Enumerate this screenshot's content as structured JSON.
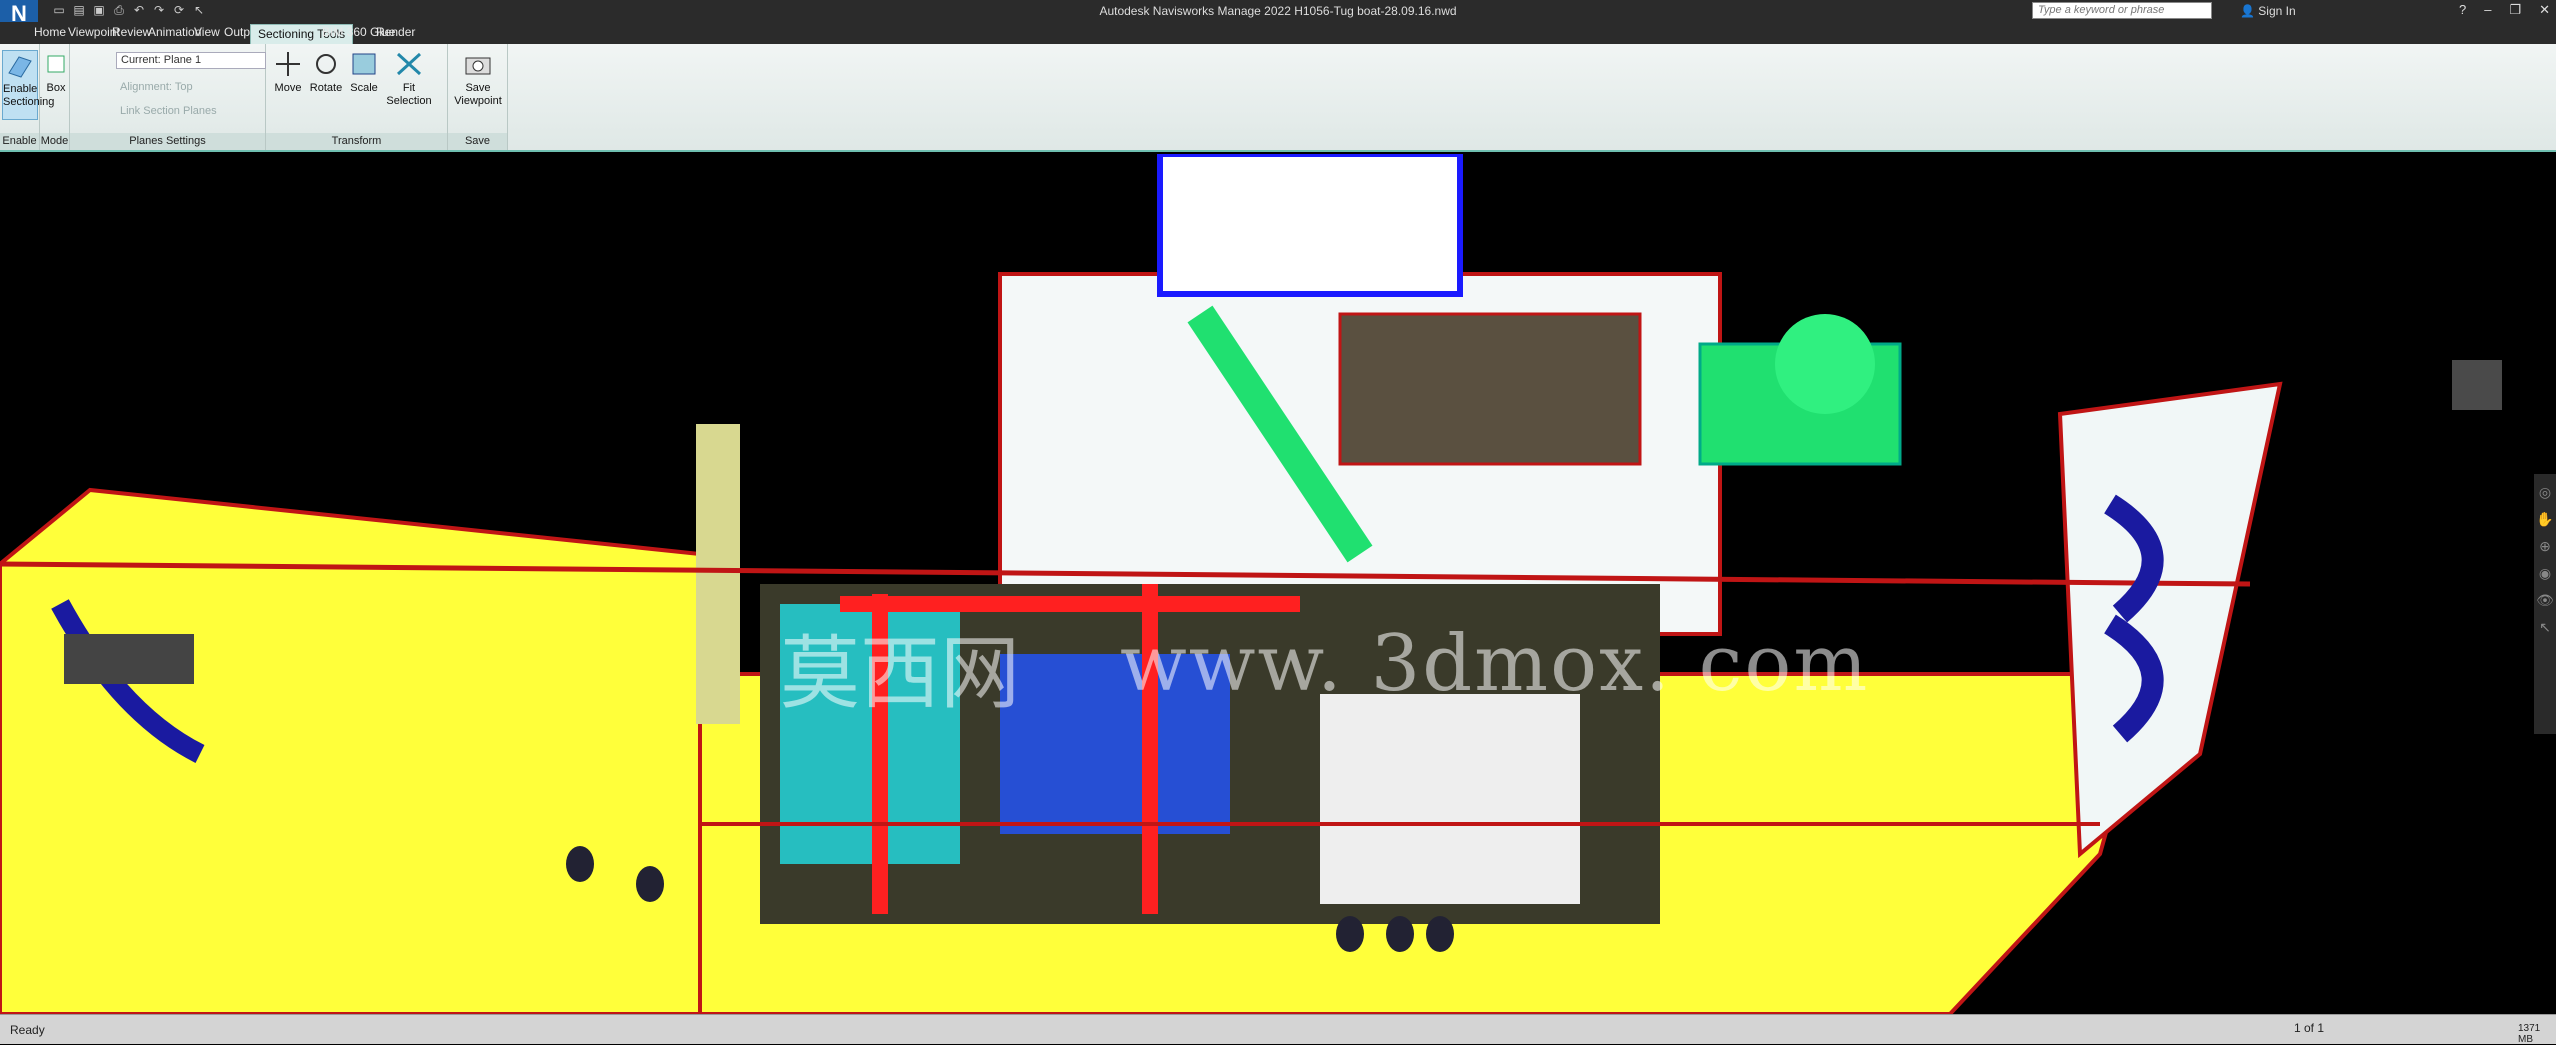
{
  "app": {
    "logo_letter": "N",
    "title": "Autodesk Navisworks Manage 2022    H1056-Tug boat-28.09.16.nwd",
    "search_placeholder": "Type a keyword or phrase",
    "sign_in": "Sign In"
  },
  "tabs": [
    "Home",
    "Viewpoint",
    "Review",
    "Animation",
    "View",
    "Output",
    "Sectioning Tools",
    "BIM 360 Glue",
    "Render"
  ],
  "active_tab": "Sectioning Tools",
  "ribbon": {
    "enable_label": "Enable\nSectioning",
    "box_label": "Box",
    "current_plane": "Current: Plane 1",
    "alignment": "Alignment: Top",
    "link_section": "Link Section Planes",
    "move_label": "Move",
    "rotate_label": "Rotate",
    "scale_label": "Scale",
    "fit_label": "Fit\nSelection",
    "save_label": "Save\nViewpoint",
    "panels": [
      "Enable",
      "Mode",
      "Planes Settings",
      "Transform",
      "Save"
    ]
  },
  "viewport": {
    "watermark_cn": "莫西网",
    "watermark": "www. 3dmox. com"
  },
  "status": {
    "ready": "Ready",
    "page": "1 of 1",
    "memory": "1371 MB"
  },
  "colors": {
    "accent": "#6fbfb0",
    "hull_yellow": "#ffff3a",
    "pipe_red": "#ff2020",
    "cabin_white": "#f4f8f8",
    "duct_cyan": "#22e0e6",
    "frame_green": "#20e070"
  }
}
